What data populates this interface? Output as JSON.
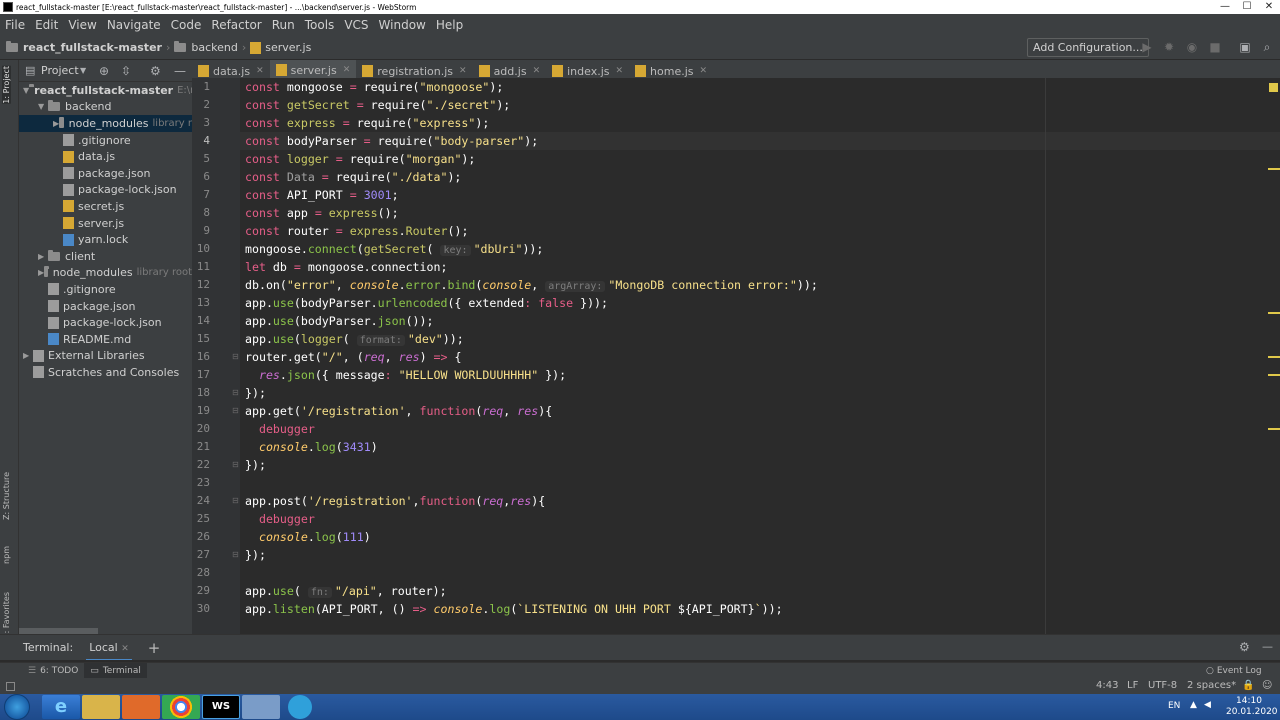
{
  "window": {
    "title": "react_fullstack-master [E:\\react_fullstack-master\\react_fullstack-master] - ...\\backend\\server.js - WebStorm",
    "controls": [
      "—",
      "☐",
      "✕"
    ]
  },
  "menu": [
    "File",
    "Edit",
    "View",
    "Navigate",
    "Code",
    "Refactor",
    "Run",
    "Tools",
    "VCS",
    "Window",
    "Help"
  ],
  "breadcrumb": {
    "project": "react_fullstack-master",
    "folder": "backend",
    "file": "server.js"
  },
  "toolbar": {
    "add_configuration": "Add Configuration..."
  },
  "left_strip": {
    "project_tab": "1: Project",
    "structure_tab": "Z: Structure",
    "npm_tab": "npm",
    "favorites_tab": "2: Favorites"
  },
  "project_panel": {
    "title": "Project",
    "tree": [
      {
        "label": "react_fullstack-master",
        "hint": "E:\\re",
        "type": "folder",
        "indent": 0,
        "arrow": "▼",
        "bold": true
      },
      {
        "label": "backend",
        "hint": "",
        "type": "folder",
        "indent": 1,
        "arrow": "▼"
      },
      {
        "label": "node_modules",
        "hint": "library r",
        "type": "folder",
        "indent": 2,
        "arrow": "▶",
        "selected": true
      },
      {
        "label": ".gitignore",
        "hint": "",
        "type": "file",
        "indent": 2
      },
      {
        "label": "data.js",
        "hint": "",
        "type": "js",
        "indent": 2
      },
      {
        "label": "package.json",
        "hint": "",
        "type": "json",
        "indent": 2
      },
      {
        "label": "package-lock.json",
        "hint": "",
        "type": "json",
        "indent": 2
      },
      {
        "label": "secret.js",
        "hint": "",
        "type": "js",
        "indent": 2
      },
      {
        "label": "server.js",
        "hint": "",
        "type": "js",
        "indent": 2
      },
      {
        "label": "yarn.lock",
        "hint": "",
        "type": "yarn",
        "indent": 2
      },
      {
        "label": "client",
        "hint": "",
        "type": "folder",
        "indent": 1,
        "arrow": "▶"
      },
      {
        "label": "node_modules",
        "hint": "library root",
        "type": "folder",
        "indent": 1,
        "arrow": "▶"
      },
      {
        "label": ".gitignore",
        "hint": "",
        "type": "file",
        "indent": 1
      },
      {
        "label": "package.json",
        "hint": "",
        "type": "json",
        "indent": 1
      },
      {
        "label": "package-lock.json",
        "hint": "",
        "type": "json",
        "indent": 1
      },
      {
        "label": "README.md",
        "hint": "",
        "type": "md",
        "indent": 1
      },
      {
        "label": "External Libraries",
        "hint": "",
        "type": "lib",
        "indent": 0,
        "arrow": "▶"
      },
      {
        "label": "Scratches and Consoles",
        "hint": "",
        "type": "scratch",
        "indent": 0
      }
    ]
  },
  "tabs": [
    {
      "label": "data.js",
      "active": false
    },
    {
      "label": "server.js",
      "active": true
    },
    {
      "label": "registration.js",
      "active": false
    },
    {
      "label": "add.js",
      "active": false
    },
    {
      "label": "index.js",
      "active": false
    },
    {
      "label": "home.js",
      "active": false
    }
  ],
  "code": {
    "current_line": 4,
    "lines": [
      [
        [
          "kw",
          "const "
        ],
        [
          "prop",
          "mongoose "
        ],
        [
          "kw",
          "= "
        ],
        [
          "prop",
          "require("
        ],
        [
          "str",
          "\"mongoose\""
        ],
        [
          "prop",
          ");"
        ]
      ],
      [
        [
          "kw",
          "const "
        ],
        [
          "fn",
          "getSecret "
        ],
        [
          "kw",
          "= "
        ],
        [
          "prop",
          "require("
        ],
        [
          "str",
          "\"./secret\""
        ],
        [
          "prop",
          ");"
        ]
      ],
      [
        [
          "kw",
          "const "
        ],
        [
          "fn",
          "express "
        ],
        [
          "kw",
          "= "
        ],
        [
          "prop",
          "require("
        ],
        [
          "str",
          "\"express\""
        ],
        [
          "prop",
          ");"
        ]
      ],
      [
        [
          "kw",
          "const "
        ],
        [
          "prop",
          "bodyParser "
        ],
        [
          "kw",
          "= "
        ],
        [
          "prop",
          "require("
        ],
        [
          "str",
          "\"body-parser\""
        ],
        [
          "prop",
          ");"
        ]
      ],
      [
        [
          "kw",
          "const "
        ],
        [
          "fn",
          "logger "
        ],
        [
          "kw",
          "= "
        ],
        [
          "prop",
          "require("
        ],
        [
          "str",
          "\"morgan\""
        ],
        [
          "prop",
          ");"
        ]
      ],
      [
        [
          "kw",
          "const "
        ],
        [
          "grayid",
          "Data "
        ],
        [
          "kw",
          "= "
        ],
        [
          "prop",
          "require("
        ],
        [
          "str",
          "\"./data\""
        ],
        [
          "prop",
          ");"
        ]
      ],
      [
        [
          "kw",
          "const "
        ],
        [
          "prop",
          "API_PORT "
        ],
        [
          "kw",
          "= "
        ],
        [
          "num",
          "3001"
        ],
        [
          "prop",
          ";"
        ]
      ],
      [
        [
          "kw",
          "const "
        ],
        [
          "prop",
          "app "
        ],
        [
          "kw",
          "= "
        ],
        [
          "fn",
          "express"
        ],
        [
          "prop",
          "();"
        ]
      ],
      [
        [
          "kw",
          "const "
        ],
        [
          "prop",
          "router "
        ],
        [
          "kw",
          "= "
        ],
        [
          "fn",
          "express"
        ],
        [
          "prop",
          "."
        ],
        [
          "fn",
          "Router"
        ],
        [
          "prop",
          "();"
        ]
      ],
      [
        [
          "prop",
          "mongoose."
        ],
        [
          "fnc",
          "connect"
        ],
        [
          "prop",
          "("
        ],
        [
          "fn",
          "getSecret"
        ],
        [
          "prop",
          "( "
        ],
        [
          "hint",
          "key:"
        ],
        [
          "str",
          "\"dbUri\""
        ],
        [
          "prop",
          "));"
        ]
      ],
      [
        [
          "kw",
          "let "
        ],
        [
          "prop",
          "db "
        ],
        [
          "kw",
          "= "
        ],
        [
          "prop",
          "mongoose.connection;"
        ]
      ],
      [
        [
          "prop",
          "db.on("
        ],
        [
          "str",
          "\"error\""
        ],
        [
          "prop",
          ", "
        ],
        [
          "it",
          "console"
        ],
        [
          "prop",
          "."
        ],
        [
          "fnc",
          "error"
        ],
        [
          "prop",
          "."
        ],
        [
          "fnc",
          "bind"
        ],
        [
          "prop",
          "("
        ],
        [
          "it",
          "console"
        ],
        [
          "prop",
          ", "
        ],
        [
          "hint",
          "argArray:"
        ],
        [
          "str",
          "\"MongoDB connection error:\""
        ],
        [
          "prop",
          "));"
        ]
      ],
      [
        [
          "prop",
          "app."
        ],
        [
          "fnc",
          "use"
        ],
        [
          "prop",
          "(bodyParser."
        ],
        [
          "fnc",
          "urlencoded"
        ],
        [
          "prop",
          "({ extended"
        ],
        [
          "kw",
          ": "
        ],
        [
          "kw",
          "false "
        ],
        [
          "prop",
          "}));"
        ]
      ],
      [
        [
          "prop",
          "app."
        ],
        [
          "fnc",
          "use"
        ],
        [
          "prop",
          "(bodyParser."
        ],
        [
          "fnc",
          "json"
        ],
        [
          "prop",
          "());"
        ]
      ],
      [
        [
          "prop",
          "app."
        ],
        [
          "fnc",
          "use"
        ],
        [
          "prop",
          "("
        ],
        [
          "fn",
          "logger"
        ],
        [
          "prop",
          "( "
        ],
        [
          "hint",
          "format:"
        ],
        [
          "str",
          "\"dev\""
        ],
        [
          "prop",
          "));"
        ]
      ],
      [
        [
          "prop",
          "router.get("
        ],
        [
          "str",
          "\"/\""
        ],
        [
          "prop",
          ", ("
        ],
        [
          "prm",
          "req"
        ],
        [
          "prop",
          ", "
        ],
        [
          "prm",
          "res"
        ],
        [
          "prop",
          ") "
        ],
        [
          "kw",
          "=> "
        ],
        [
          "prop",
          "{"
        ]
      ],
      [
        [
          "prop",
          "  "
        ],
        [
          "prm",
          "res"
        ],
        [
          "prop",
          "."
        ],
        [
          "fnc",
          "json"
        ],
        [
          "prop",
          "({ message"
        ],
        [
          "kw",
          ": "
        ],
        [
          "str",
          "\"HELLOW WORLDUUHHHH\""
        ],
        [
          "prop",
          " });"
        ]
      ],
      [
        [
          "prop",
          "});"
        ]
      ],
      [
        [
          "prop",
          "app.get("
        ],
        [
          "str",
          "'/registration'"
        ],
        [
          "prop",
          ", "
        ],
        [
          "kw",
          "function"
        ],
        [
          "prop",
          "("
        ],
        [
          "prm",
          "req"
        ],
        [
          "prop",
          ", "
        ],
        [
          "prm",
          "res"
        ],
        [
          "prop",
          "){"
        ]
      ],
      [
        [
          "prop",
          "  "
        ],
        [
          "kw",
          "debugger"
        ]
      ],
      [
        [
          "prop",
          "  "
        ],
        [
          "it",
          "console"
        ],
        [
          "prop",
          "."
        ],
        [
          "fnc",
          "log"
        ],
        [
          "prop",
          "("
        ],
        [
          "num",
          "3431"
        ],
        [
          "prop",
          ")"
        ]
      ],
      [
        [
          "prop",
          "});"
        ]
      ],
      [
        [
          "prop",
          ""
        ]
      ],
      [
        [
          "prop",
          "app.post("
        ],
        [
          "str",
          "'/registration'"
        ],
        [
          "prop",
          ","
        ],
        [
          "kw",
          "function"
        ],
        [
          "prop",
          "("
        ],
        [
          "prm",
          "req"
        ],
        [
          "prop",
          ","
        ],
        [
          "prm",
          "res"
        ],
        [
          "prop",
          "){"
        ]
      ],
      [
        [
          "prop",
          "  "
        ],
        [
          "kw",
          "debugger"
        ]
      ],
      [
        [
          "prop",
          "  "
        ],
        [
          "it",
          "console"
        ],
        [
          "prop",
          "."
        ],
        [
          "fnc",
          "log"
        ],
        [
          "prop",
          "("
        ],
        [
          "num",
          "111"
        ],
        [
          "prop",
          ")"
        ]
      ],
      [
        [
          "prop",
          "});"
        ]
      ],
      [
        [
          "prop",
          ""
        ]
      ],
      [
        [
          "prop",
          "app."
        ],
        [
          "fnc",
          "use"
        ],
        [
          "prop",
          "( "
        ],
        [
          "hint",
          "fn:"
        ],
        [
          "str",
          "\"/api\""
        ],
        [
          "prop",
          ", router);"
        ]
      ],
      [
        [
          "prop",
          "app."
        ],
        [
          "fnc",
          "listen"
        ],
        [
          "prop",
          "(API_PORT, () "
        ],
        [
          "kw",
          "=> "
        ],
        [
          "it",
          "console"
        ],
        [
          "prop",
          "."
        ],
        [
          "fnc",
          "log"
        ],
        [
          "prop",
          "("
        ],
        [
          "str",
          "`LISTENING ON UHH PORT "
        ],
        [
          "prop",
          "${API_PORT}"
        ],
        [
          "str",
          "`"
        ],
        [
          "prop",
          "));"
        ]
      ]
    ]
  },
  "terminal": {
    "label": "Terminal:",
    "tab": "Local",
    "close": "✕",
    "add": "+"
  },
  "bottom_tabs": {
    "todo": "6: TODO",
    "terminal": "Terminal",
    "event_log": "Event Log"
  },
  "status": {
    "position": "4:43",
    "line_sep": "LF",
    "encoding": "UTF-8",
    "indent": "2 spaces*"
  },
  "taskbar": {
    "lang": "EN",
    "time": "14:10",
    "date": "20.01.2020"
  },
  "colors": {
    "accent": "#4a88c7",
    "keyword": "#e65e88",
    "string": "#f7e08a",
    "number": "#a08bfa"
  }
}
